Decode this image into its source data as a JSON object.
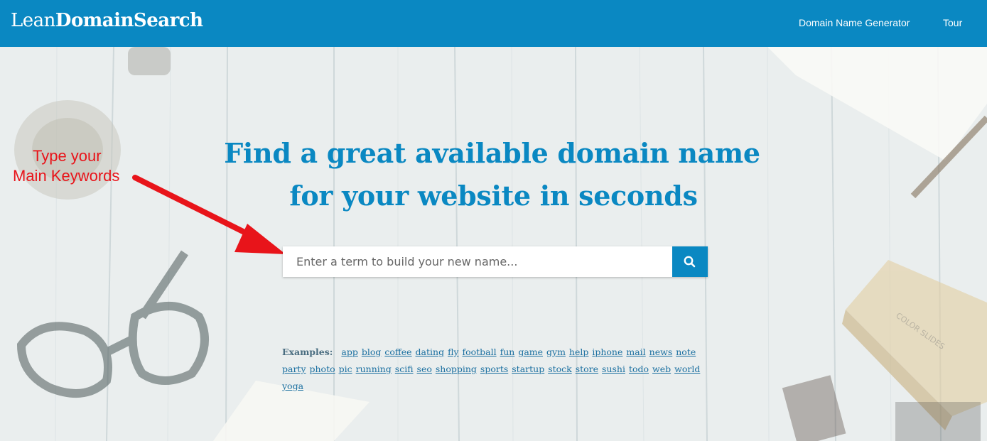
{
  "header": {
    "logo_light": "Lean",
    "logo_bold": "DomainSearch",
    "nav": [
      {
        "label": "Domain Name Generator"
      },
      {
        "label": "Tour"
      }
    ]
  },
  "hero": {
    "headline_line1": "Find a great available domain name",
    "headline_line2": "for your website in seconds"
  },
  "search": {
    "placeholder": "Enter a term to build your new name...",
    "value": "",
    "button_icon": "search-icon"
  },
  "annotation": {
    "line1": "Type your",
    "line2": "Main Keywords",
    "color": "#e8141a"
  },
  "examples": {
    "label": "Examples:",
    "terms": [
      "app",
      "blog",
      "coffee",
      "dating",
      "fly",
      "football",
      "fun",
      "game",
      "gym",
      "help",
      "iphone",
      "mail",
      "news",
      "note",
      "party",
      "photo",
      "pic",
      "running",
      "scifi",
      "seo",
      "shopping",
      "sports",
      "startup",
      "stock",
      "store",
      "sushi",
      "todo",
      "web",
      "world",
      "yoga"
    ]
  },
  "colors": {
    "brand": "#0a88c2",
    "annotation": "#e8141a"
  }
}
